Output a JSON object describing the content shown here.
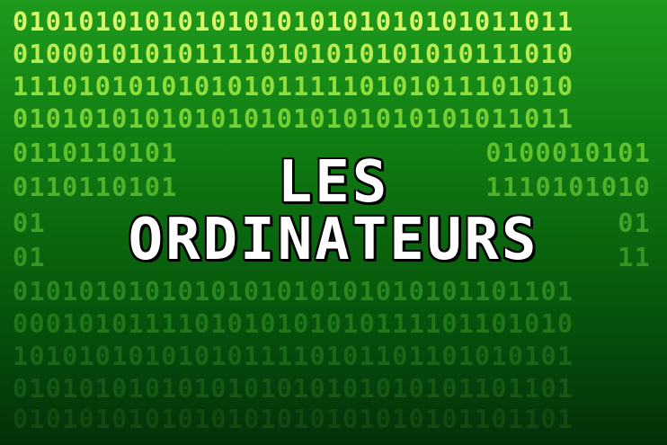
{
  "title": {
    "line1": "LES",
    "line2": "ORDINATEURS"
  },
  "binary_rows": [
    {
      "text": "0101010101010101010101010101011011",
      "color": "#d9f76a"
    },
    {
      "text": "0100010101011110101010101010111010",
      "color": "#b6ec52"
    },
    {
      "text": "1110101010101010111110101011101010",
      "color": "#8fde3c"
    },
    {
      "text": "0101010101010101010101010101011011",
      "color": "#76cf33"
    }
  ],
  "side_rows": {
    "left": [
      {
        "text": "0110110101",
        "color": "#5fc12e"
      },
      {
        "text": "0110110101",
        "color": "#4fb22a"
      },
      {
        "text": "01",
        "color": "#3ea326"
      },
      {
        "text": "01",
        "color": "#339622"
      }
    ],
    "right": [
      {
        "text": "0100010101",
        "color": "#5fc12e"
      },
      {
        "text": "1110101010",
        "color": "#4fb22a"
      },
      {
        "text": "01",
        "color": "#3ea326"
      },
      {
        "text": "11",
        "color": "#339622"
      }
    ]
  },
  "bottom_rows": [
    {
      "text": "0101010101010101010101010101101101",
      "color": "#2a861e"
    },
    {
      "text": "0001010111101010101010111101101010",
      "color": "#21761a"
    },
    {
      "text": "1010101010101011110101101101010101",
      "color": "#1a6616"
    },
    {
      "text": "0101010101010101010101010101101101",
      "color": "#155813"
    },
    {
      "text": "0101010101010101010101010101101101",
      "color": "#104a10"
    }
  ]
}
